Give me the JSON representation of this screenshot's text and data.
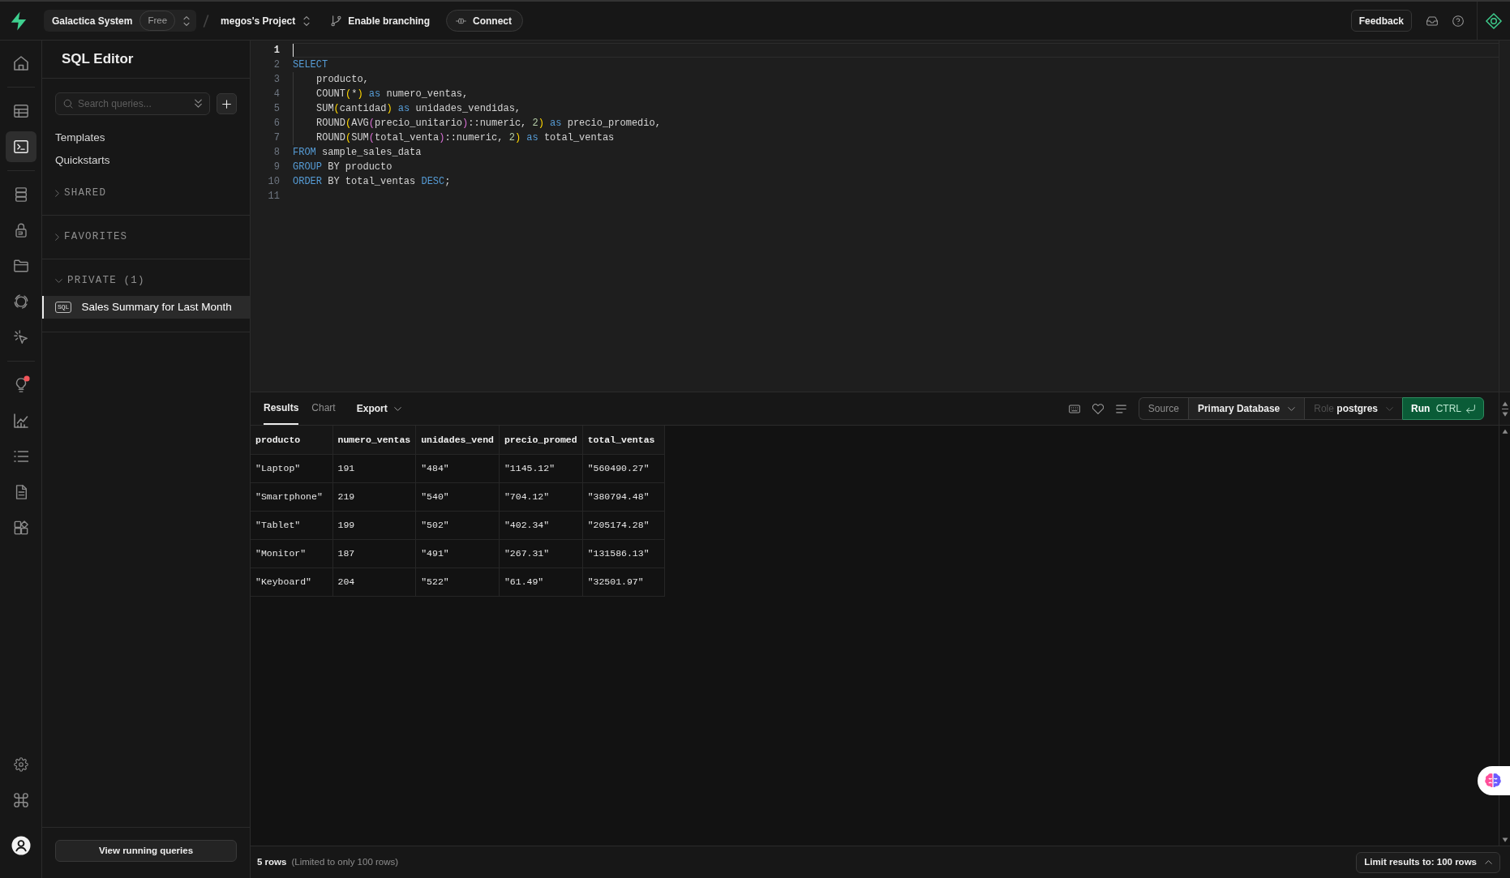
{
  "topbar": {
    "org": {
      "name": "Galactica System",
      "plan": "Free"
    },
    "project": {
      "name": "megos's Project"
    },
    "branching": {
      "label": "Enable branching"
    },
    "connect": {
      "label": "Connect"
    },
    "feedback": {
      "label": "Feedback"
    }
  },
  "rail": {
    "groups": [
      [
        {
          "kind": "home",
          "selected": false,
          "notification": false
        }
      ],
      [
        {
          "kind": "table",
          "selected": false,
          "notification": false
        },
        {
          "kind": "sql",
          "selected": true,
          "notification": false
        }
      ],
      [
        {
          "kind": "database",
          "selected": false,
          "notification": false
        },
        {
          "kind": "auth",
          "selected": false,
          "notification": false
        },
        {
          "kind": "storage",
          "selected": false,
          "notification": false
        },
        {
          "kind": "realtime",
          "selected": false,
          "notification": false
        },
        {
          "kind": "functions",
          "selected": false,
          "notification": false
        }
      ],
      [
        {
          "kind": "advisors",
          "selected": false,
          "notification": true
        },
        {
          "kind": "reports",
          "selected": false,
          "notification": false
        },
        {
          "kind": "logs",
          "selected": false,
          "notification": false
        },
        {
          "kind": "docs",
          "selected": false,
          "notification": false
        },
        {
          "kind": "integrations",
          "selected": false,
          "notification": false
        }
      ]
    ],
    "bottom": [
      {
        "kind": "settings",
        "selected": false,
        "notification": false
      },
      {
        "kind": "command",
        "selected": false,
        "notification": false
      },
      {
        "kind": "account",
        "selected": false,
        "notification": false
      }
    ]
  },
  "sidebar": {
    "title": "SQL Editor",
    "search": {
      "placeholder": "Search queries..."
    },
    "links": [
      {
        "label": "Templates"
      },
      {
        "label": "Quickstarts"
      }
    ],
    "sections": [
      {
        "title": "SHARED",
        "expanded": false
      },
      {
        "title": "FAVORITES",
        "expanded": false
      },
      {
        "title": "PRIVATE (1)",
        "expanded": true,
        "items": [
          {
            "tag": "SQL",
            "label": "Sales Summary for Last Month",
            "selected": true
          }
        ]
      }
    ],
    "footer_button": "View running queries"
  },
  "editor": {
    "lines": [
      {
        "number": "1",
        "current": true
      },
      {
        "number": "2",
        "current": false,
        "indent": false,
        "tokens": [
          {
            "kind": "keyword",
            "text": "SELECT"
          }
        ]
      },
      {
        "number": "3",
        "current": false,
        "indent": true,
        "tokens": [
          {
            "kind": "plain",
            "text": "producto,"
          }
        ]
      },
      {
        "number": "4",
        "current": false,
        "indent": true,
        "tokens": [
          {
            "kind": "plain",
            "text": "COUNT"
          },
          {
            "kind": "bracket",
            "text": "("
          },
          {
            "kind": "plain",
            "text": "*"
          },
          {
            "kind": "bracket",
            "text": ")"
          },
          {
            "kind": "keyword",
            "text": " as "
          },
          {
            "kind": "plain",
            "text": "numero_ventas,"
          }
        ]
      },
      {
        "number": "5",
        "current": false,
        "indent": true,
        "tokens": [
          {
            "kind": "plain",
            "text": "SUM"
          },
          {
            "kind": "bracket",
            "text": "("
          },
          {
            "kind": "plain",
            "text": "cantidad"
          },
          {
            "kind": "bracket",
            "text": ")"
          },
          {
            "kind": "keyword",
            "text": " as "
          },
          {
            "kind": "plain",
            "text": "unidades_vendidas,"
          }
        ]
      },
      {
        "number": "6",
        "current": false,
        "indent": true,
        "tokens": [
          {
            "kind": "plain",
            "text": "ROUND"
          },
          {
            "kind": "bracket",
            "text": "("
          },
          {
            "kind": "plain",
            "text": "AVG"
          },
          {
            "kind": "bracket2",
            "text": "("
          },
          {
            "kind": "plain",
            "text": "precio_unitario"
          },
          {
            "kind": "bracket2",
            "text": ")"
          },
          {
            "kind": "plain",
            "text": "::numeric, "
          },
          {
            "kind": "number",
            "text": "2"
          },
          {
            "kind": "bracket",
            "text": ")"
          },
          {
            "kind": "keyword",
            "text": " as "
          },
          {
            "kind": "plain",
            "text": "precio_promedio,"
          }
        ]
      },
      {
        "number": "7",
        "current": false,
        "indent": true,
        "tokens": [
          {
            "kind": "plain",
            "text": "ROUND"
          },
          {
            "kind": "bracket",
            "text": "("
          },
          {
            "kind": "plain",
            "text": "SUM"
          },
          {
            "kind": "bracket2",
            "text": "("
          },
          {
            "kind": "plain",
            "text": "total_venta"
          },
          {
            "kind": "bracket2",
            "text": ")"
          },
          {
            "kind": "plain",
            "text": "::numeric, "
          },
          {
            "kind": "number",
            "text": "2"
          },
          {
            "kind": "bracket",
            "text": ")"
          },
          {
            "kind": "keyword",
            "text": " as "
          },
          {
            "kind": "plain",
            "text": "total_ventas"
          }
        ]
      },
      {
        "number": "8",
        "current": false,
        "indent": false,
        "tokens": [
          {
            "kind": "keyword",
            "text": "FROM"
          },
          {
            "kind": "plain",
            "text": " sample_sales_data"
          }
        ]
      },
      {
        "number": "9",
        "current": false,
        "indent": false,
        "tokens": [
          {
            "kind": "keyword",
            "text": "GROUP"
          },
          {
            "kind": "plain",
            "text": " BY producto"
          }
        ]
      },
      {
        "number": "10",
        "current": false,
        "indent": false,
        "tokens": [
          {
            "kind": "keyword",
            "text": "ORDER"
          },
          {
            "kind": "plain",
            "text": " BY total_ventas "
          },
          {
            "kind": "keyword",
            "text": "DESC"
          },
          {
            "kind": "plain",
            "text": ";"
          }
        ]
      },
      {
        "number": "11",
        "current": false
      }
    ]
  },
  "results": {
    "tabs": [
      {
        "label": "Results",
        "selected": true
      },
      {
        "label": "Chart",
        "selected": false
      }
    ],
    "export": "Export",
    "source": {
      "label": "Source",
      "value": "Primary Database"
    },
    "role": {
      "label": "Role",
      "value": "postgres"
    },
    "run": {
      "label": "Run",
      "shortcut": "CTRL"
    },
    "table": {
      "columns": [
        "producto",
        "numero_ventas",
        "unidades_vend",
        "precio_promed",
        "total_ventas"
      ],
      "rows": [
        [
          "\"Laptop\"",
          "191",
          "\"484\"",
          "\"1145.12\"",
          "\"560490.27\""
        ],
        [
          "\"Smartphone\"",
          "219",
          "\"540\"",
          "\"704.12\"",
          "\"380794.48\""
        ],
        [
          "\"Tablet\"",
          "199",
          "\"502\"",
          "\"402.34\"",
          "\"205174.28\""
        ],
        [
          "\"Monitor\"",
          "187",
          "\"491\"",
          "\"267.31\"",
          "\"131586.13\""
        ],
        [
          "\"Keyboard\"",
          "204",
          "\"522\"",
          "\"61.49\"",
          "\"32501.97\""
        ]
      ]
    }
  },
  "status_bar": {
    "count": "5 rows",
    "note": "(Limited to only 100 rows)",
    "limit": "Limit results to: 100 rows"
  }
}
